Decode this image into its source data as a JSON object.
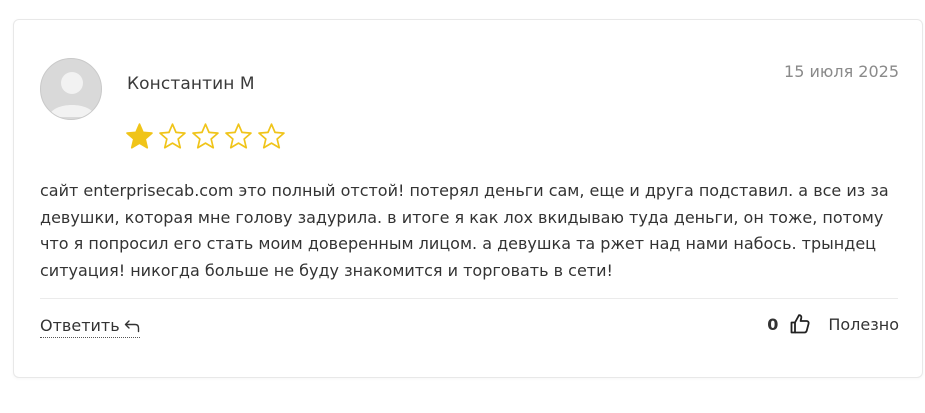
{
  "review": {
    "author": "Константин М",
    "date": "15 июля 2025",
    "rating": 1,
    "max_rating": 5,
    "text": "сайт enterprisecab.com это полный отстой! потерял деньги сам, еще и друга подставил. а все из за девушки, которая мне голову задурила. в итоге я как лох вкидываю туда деньги, он тоже, потому что я попросил его стать моим доверенным лицом. а девушка та ржет над нами набось. трындец ситуация! никогда больше не буду знакомится и торговать в сети!"
  },
  "actions": {
    "reply_label": "Ответить",
    "helpful_count": "0",
    "helpful_label": "Полезно"
  },
  "icons": {
    "avatar": "user-avatar-placeholder-icon",
    "star_filled": "star-filled-icon",
    "star_empty": "star-outline-icon",
    "reply": "reply-arrow-icon",
    "thumb": "thumbs-up-icon"
  },
  "colors": {
    "star": "#f0c419",
    "text": "#333333",
    "date": "#8a8a8a"
  }
}
